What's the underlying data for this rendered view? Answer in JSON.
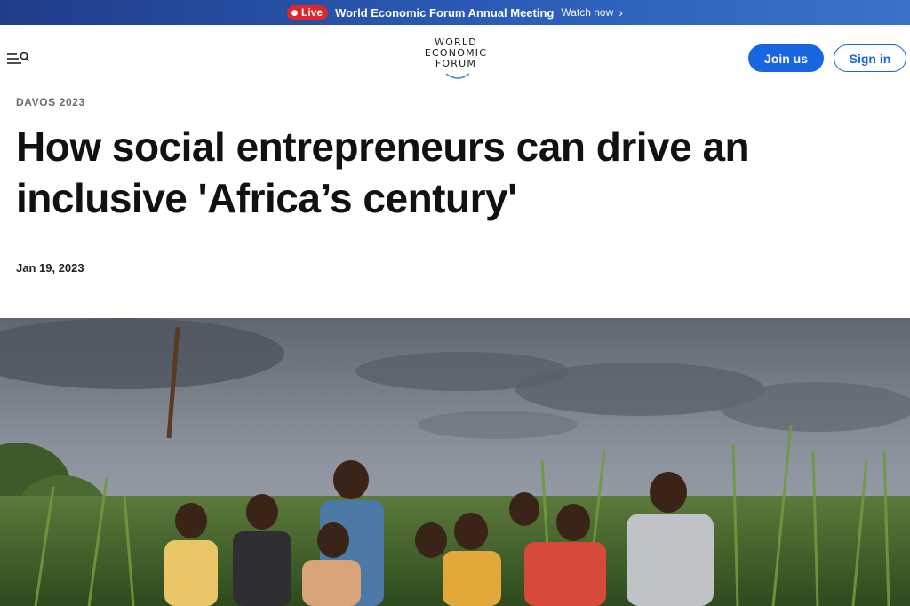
{
  "banner": {
    "live_label": "Live",
    "title": "World Economic Forum Annual Meeting",
    "watch_label": "Watch now"
  },
  "header": {
    "logo_lines": [
      "WORLD",
      "ECONOMIC",
      "FORUM"
    ],
    "join_label": "Join us",
    "signin_label": "Sign in"
  },
  "article": {
    "kicker": "DAVOS 2023",
    "headline": "How social entrepreneurs can drive an inclusive 'Africa’s century'",
    "date": "Jan 19, 2023"
  },
  "colors": {
    "brand_blue": "#1a66e0",
    "live_red": "#e0262d",
    "banner_blue": "#2b5cb8"
  },
  "icons": {
    "menu": "menu-search-icon",
    "watch": "chevron-right-icon"
  }
}
